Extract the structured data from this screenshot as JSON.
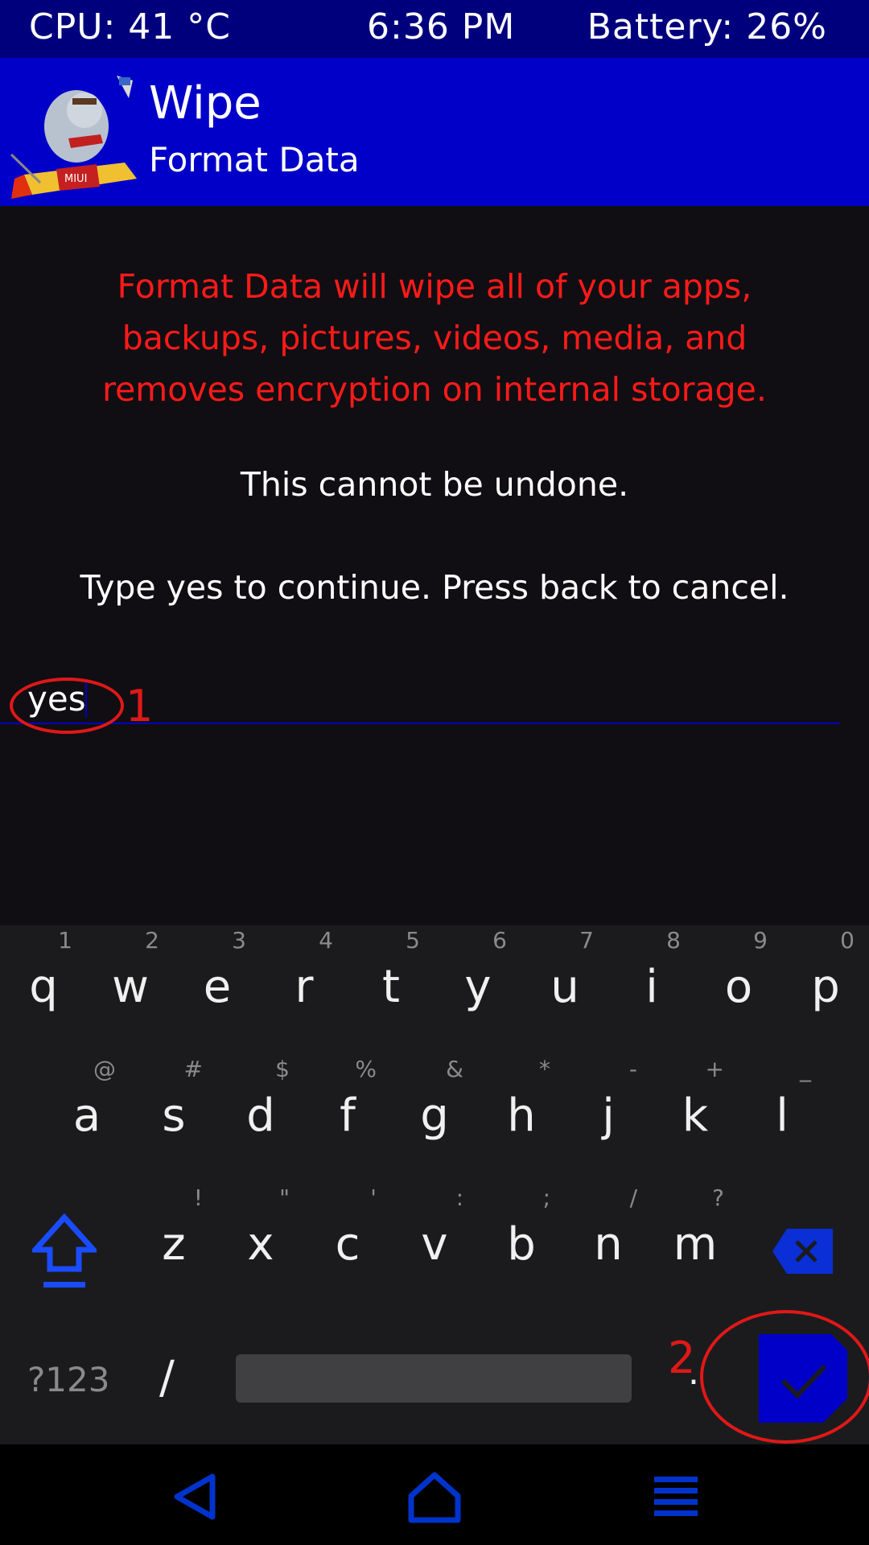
{
  "status_bar": {
    "cpu": "CPU: 41 °C",
    "time": "6:36 PM",
    "battery": "Battery: 26%"
  },
  "header": {
    "title": "Wipe",
    "subtitle": "Format Data",
    "logo_text": "MIUI"
  },
  "content": {
    "warning_lines": [
      "Format Data will wipe all of your apps,",
      "backups, pictures, videos, media, and",
      "removes encryption on internal storage."
    ],
    "undone_text": "This cannot be undone.",
    "instruction_text": "Type yes to continue.  Press back to cancel.",
    "input_value": "yes"
  },
  "annotations": {
    "step1": "1",
    "step2": "2"
  },
  "keyboard": {
    "row1": [
      {
        "key": "q",
        "hint": "1"
      },
      {
        "key": "w",
        "hint": "2"
      },
      {
        "key": "e",
        "hint": "3"
      },
      {
        "key": "r",
        "hint": "4"
      },
      {
        "key": "t",
        "hint": "5"
      },
      {
        "key": "y",
        "hint": "6"
      },
      {
        "key": "u",
        "hint": "7"
      },
      {
        "key": "i",
        "hint": "8"
      },
      {
        "key": "o",
        "hint": "9"
      },
      {
        "key": "p",
        "hint": "0"
      }
    ],
    "row2": [
      {
        "key": "a",
        "hint": "@"
      },
      {
        "key": "s",
        "hint": "#"
      },
      {
        "key": "d",
        "hint": "$"
      },
      {
        "key": "f",
        "hint": "%"
      },
      {
        "key": "g",
        "hint": "&"
      },
      {
        "key": "h",
        "hint": "*"
      },
      {
        "key": "j",
        "hint": "-"
      },
      {
        "key": "k",
        "hint": "+"
      },
      {
        "key": "l",
        "hint": "_"
      }
    ],
    "row3": [
      {
        "key": "z",
        "hint": "!"
      },
      {
        "key": "x",
        "hint": "\""
      },
      {
        "key": "c",
        "hint": "'"
      },
      {
        "key": "v",
        "hint": ":"
      },
      {
        "key": "b",
        "hint": ";"
      },
      {
        "key": "n",
        "hint": "/"
      },
      {
        "key": "m",
        "hint": "?"
      }
    ],
    "symbols_label": "?123",
    "slash_label": "/",
    "period_label": "."
  },
  "colors": {
    "header_bg": "#0000c8",
    "status_bg": "#00007d",
    "warning": "#ff1a1a",
    "annotation": "#e01818",
    "accent": "#0033cc"
  }
}
